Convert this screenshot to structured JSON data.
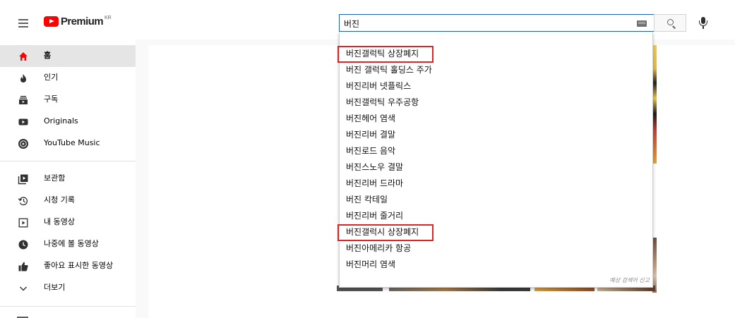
{
  "header": {
    "logo_text": "Premium",
    "logo_region": "KR",
    "search_value": "버진"
  },
  "sidebar": {
    "primary": [
      {
        "label": "홈",
        "icon": "home-icon",
        "active": true
      },
      {
        "label": "인기",
        "icon": "trending-icon",
        "active": false
      },
      {
        "label": "구독",
        "icon": "subscriptions-icon",
        "active": false
      },
      {
        "label": "Originals",
        "icon": "originals-icon",
        "active": false
      },
      {
        "label": "YouTube Music",
        "icon": "youtube-music-icon",
        "active": false
      }
    ],
    "library": [
      {
        "label": "보관함",
        "icon": "library-icon"
      },
      {
        "label": "시청 기록",
        "icon": "history-icon"
      },
      {
        "label": "내 동영상",
        "icon": "your-videos-icon"
      },
      {
        "label": "나중에 볼 동영상",
        "icon": "watch-later-icon"
      },
      {
        "label": "좋아요 표시한 동영상",
        "icon": "liked-videos-icon"
      },
      {
        "label": "더보기",
        "icon": "chevron-down-icon"
      }
    ]
  },
  "suggestions": {
    "items": [
      {
        "text": "버진갤럭틱 상장폐지",
        "highlighted": true
      },
      {
        "text": "버진 갤럭틱 홀딩스 주가",
        "highlighted": false
      },
      {
        "text": "버진리버 넷플릭스",
        "highlighted": false
      },
      {
        "text": "버진갤럭틱 우주공항",
        "highlighted": false
      },
      {
        "text": "버진헤어 염색",
        "highlighted": false
      },
      {
        "text": "버진리버 결말",
        "highlighted": false
      },
      {
        "text": "버진로드 음악",
        "highlighted": false
      },
      {
        "text": "버진스노우 결말",
        "highlighted": false
      },
      {
        "text": "버진리버 드라마",
        "highlighted": false
      },
      {
        "text": "버진 칵테일",
        "highlighted": false
      },
      {
        "text": "버진리버 줄거리",
        "highlighted": false
      },
      {
        "text": "버진갤럭시 상장폐지",
        "highlighted": true
      },
      {
        "text": "버진아메리카 항공",
        "highlighted": false
      },
      {
        "text": "버진머리 염색",
        "highlighted": false
      }
    ],
    "report_label": "예상 검색어 신고"
  },
  "colors": {
    "accent": "#ff0000",
    "search_border": "#1c62b9",
    "highlight_box": "#d62828",
    "active_nav_bg": "#e5e5e5"
  }
}
